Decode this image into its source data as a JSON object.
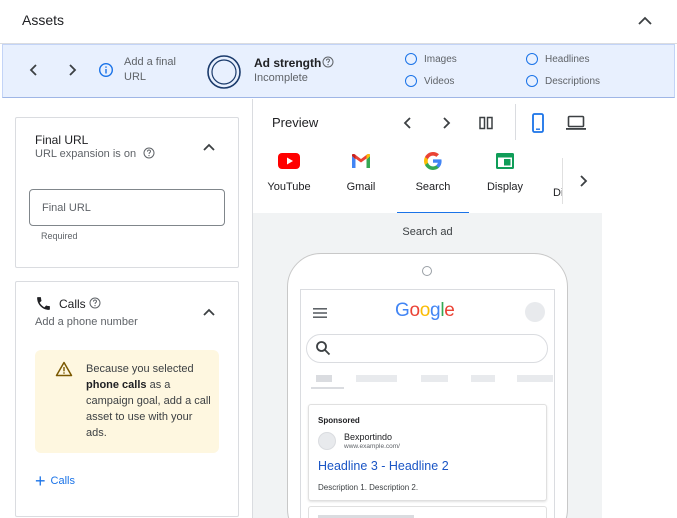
{
  "header": {
    "title": "Assets"
  },
  "strength_strip": {
    "add_final_url": "Add a final URL",
    "ad_strength_label": "Ad strength",
    "ad_strength_value": "Incomplete",
    "requirements": [
      "Images",
      "Videos",
      "Headlines",
      "Descriptions"
    ]
  },
  "final_url_card": {
    "title": "Final URL",
    "subtitle": "URL expansion is on",
    "input_placeholder": "Final URL",
    "input_value": "",
    "helper": "Required"
  },
  "calls_card": {
    "title": "Calls",
    "subtitle": "Add a phone number",
    "warning_pre": "Because you selected ",
    "warning_bold": "phone calls",
    "warning_post": " as a campaign goal, add a call asset to use with your ads.",
    "add_label": "Calls"
  },
  "preview": {
    "title": "Preview",
    "tabs": [
      "YouTube",
      "Gmail",
      "Search",
      "Display",
      "Di"
    ],
    "active_tab": "Search",
    "type_label": "Search ad",
    "google_logo": "Google",
    "ad": {
      "sponsored": "Sponsored",
      "advertiser": "Bexportindo",
      "url": "www.example.com/",
      "headline": "Headline 3 - Headline 2",
      "description": "Description 1. Description 2."
    }
  },
  "colors": {
    "accent": "#1a73e8",
    "strip_bg": "#e8f0fe",
    "warning_bg": "#fef7e0",
    "preview_bg": "#f1f3f4"
  },
  "icons": [
    "chevron-up-icon",
    "chevron-left-icon",
    "chevron-right-icon",
    "info-icon",
    "help-icon",
    "phone-icon",
    "warning-icon",
    "plus-icon",
    "columns-icon",
    "mobile-icon",
    "desktop-icon",
    "youtube-icon",
    "gmail-icon",
    "google-icon",
    "display-icon",
    "menu-icon",
    "search-icon"
  ]
}
